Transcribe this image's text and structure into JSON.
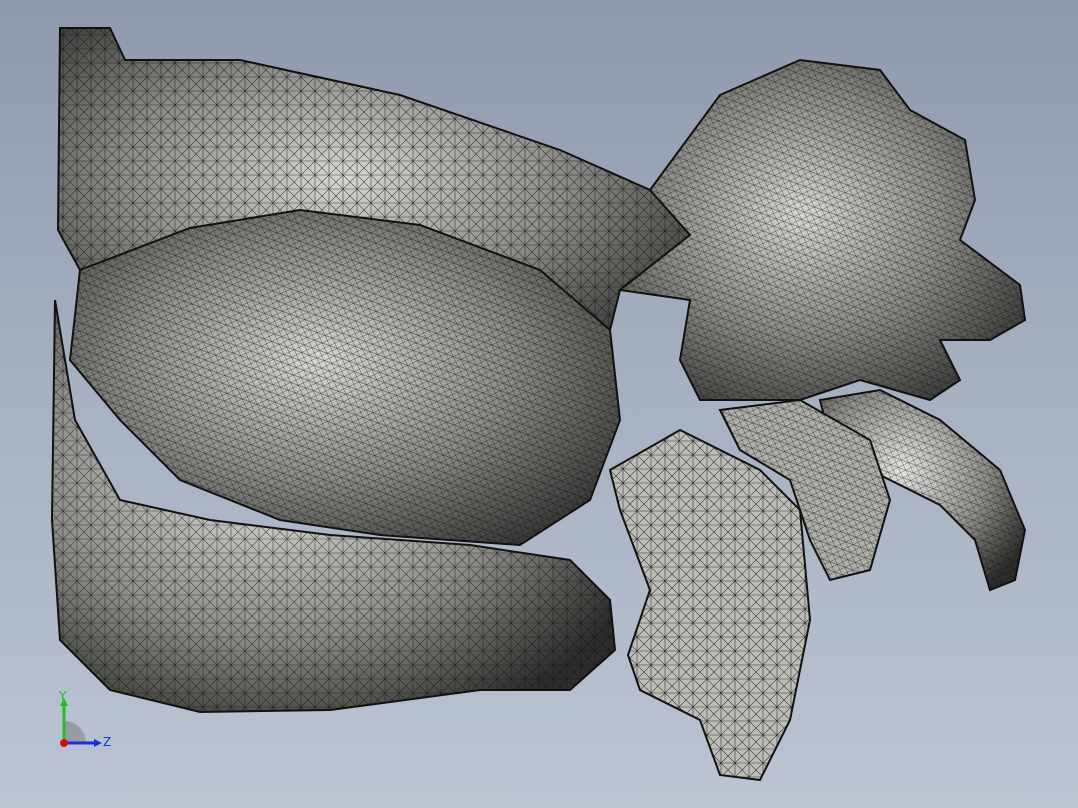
{
  "viewport": {
    "model": "mesh-body"
  },
  "triad": {
    "y_label": "Y",
    "z_label": "Z",
    "colors": {
      "y": "#1fc01f",
      "z": "#1a2fd6",
      "x": "#d01010"
    }
  },
  "colors": {
    "background_top": "#8e9aad",
    "background_bottom": "#bcc4d2",
    "mesh_fill_dark": "#3e3e3e",
    "mesh_fill_light": "#c8c8c4",
    "mesh_line": "#111111"
  }
}
